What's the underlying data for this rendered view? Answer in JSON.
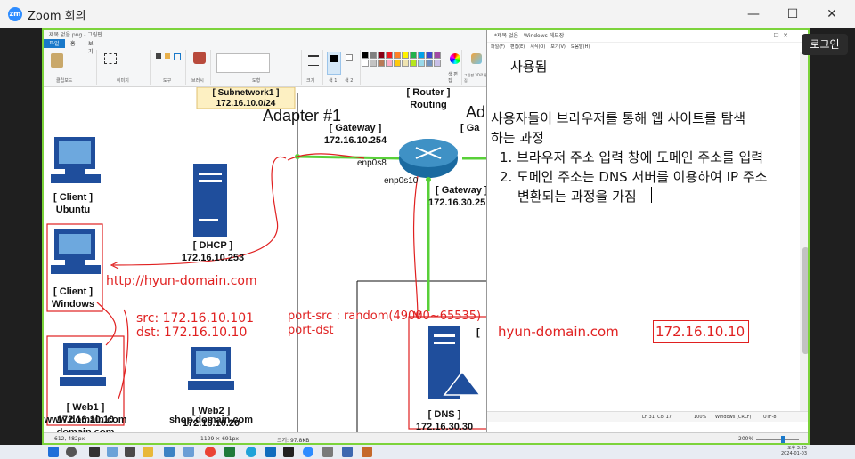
{
  "zoom": {
    "title": "Zoom 회의",
    "login": "로그인",
    "minimize": "—",
    "maximize": "☐",
    "close": "✕",
    "logo_text": "zm"
  },
  "paint": {
    "window_title": "제목 없음.png - 그림판",
    "tabs": [
      "파일",
      "홈",
      "보기"
    ],
    "groups": [
      "클립보드",
      "이미지",
      "도구",
      "브러시",
      "도형",
      "크기",
      "색 1",
      "색 2",
      "색 편집",
      "그림판 3D로 편집"
    ],
    "status": {
      "cursor": "612, 482px",
      "selection": "1129 × 691px",
      "size": "크기: 97.8KB",
      "zoom": "200%"
    }
  },
  "diagram": {
    "subnet": "[ Subnetwork1 ]",
    "subnet_ip": "172.16.10.0/24",
    "adapter1": "Adapter #1",
    "adapter2": "Ad",
    "router": "[ Router ]",
    "router_sub": "Routing",
    "gateway1": "[ Gateway ]",
    "gateway1_ip": "172.16.10.254",
    "gateway2_partial": "[ Ga",
    "enp0s8": "enp0s8",
    "enp0s10": "enp0s10",
    "gateway3": "[ Gateway ]",
    "gateway3_ip": "172.16.30.25",
    "client_ubuntu": "[ Client ]",
    "client_ubuntu_sub": "Ubuntu",
    "client_windows": "[ Client ]",
    "client_windows_sub": "Windows",
    "dhcp": "[ DHCP ]",
    "dhcp_ip": "172.16.10.253",
    "url": "http://hyun-domain.com",
    "src": "src: 172.16.10.101",
    "dst": "dst: 172.16.10.10",
    "port_src": "port-src : random(49000~65535)",
    "port_dst": "port-dst",
    "web1": "[ Web1 ]",
    "web1_ip": "172.16.10.10",
    "web1_domain": "domain.com",
    "web1_www": "www.domain.com",
    "web2": "[ Web2 ]",
    "web2_ip": "172.16.10.20",
    "web2_domain": "shop.domain.com",
    "dns": "[ DNS ]",
    "dns_ip": "172.16.30.30",
    "bracket_partial": "[",
    "hyun_domain": "hyun-domain.com",
    "resolved_ip": "172.16.10.10"
  },
  "notepad": {
    "title": "*제목 없음 - Windows 메모장",
    "menu": [
      "파일(F)",
      "편집(E)",
      "서식(O)",
      "보기(V)",
      "도움말(H)"
    ],
    "line1": "사용됨",
    "para1": "사용자들이 브라우저를 통해 웹 사이트를 탐색",
    "para2": "하는 과정",
    "item1": "1. 브라우저 주소 입력 창에 도메인 주소를 입력",
    "item2": "2. 도메인 주소는 DNS 서버를 이용하여 IP 주소",
    "item2b": "변환되는 과정을 가짐",
    "status_pos": "Ln 31, Col 17",
    "status_zoom": "100%",
    "status_eol": "Windows (CRLF)",
    "status_enc": "UTF-8"
  },
  "taskbar": {
    "time": "오후 3:25",
    "date": "2024-01-03"
  },
  "colors": {
    "accent_green": "#7cd33b",
    "zoom_blue": "#2d8cff",
    "annotation_red": "#e02020",
    "server_blue": "#1f4e9c"
  }
}
